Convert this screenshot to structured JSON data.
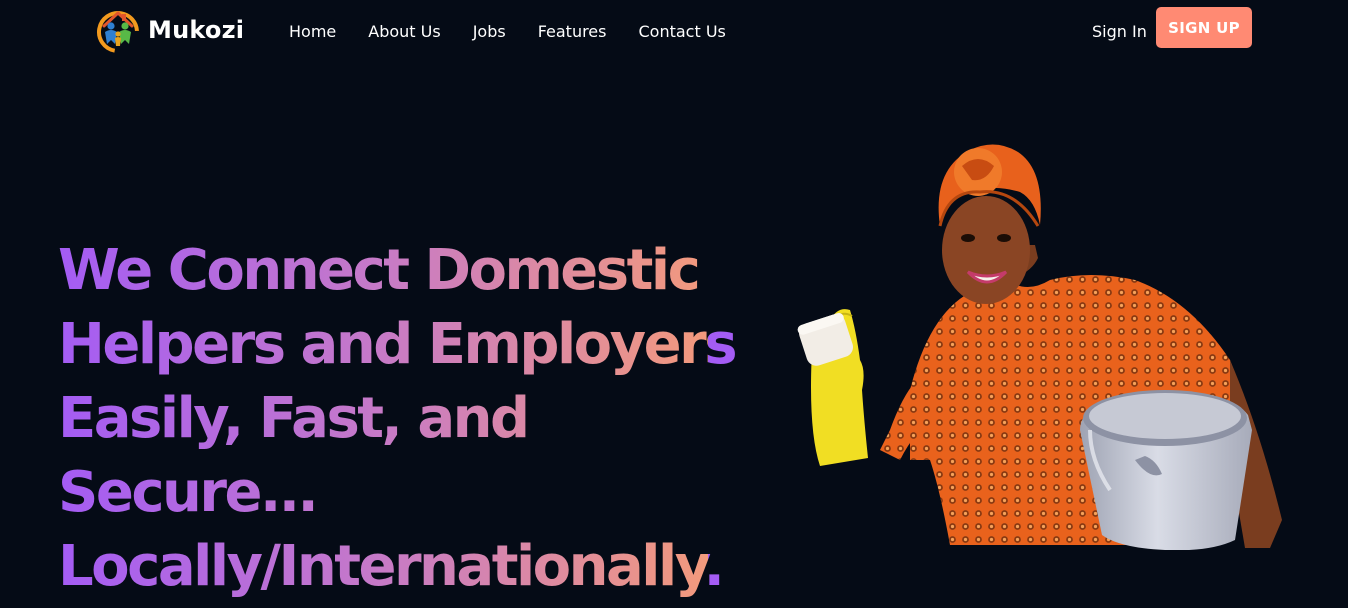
{
  "brand": {
    "name": "Mukozi",
    "logo_icon": "house-family-logo-icon"
  },
  "nav": {
    "items": [
      {
        "label": "Home"
      },
      {
        "label": "About Us"
      },
      {
        "label": "Jobs"
      },
      {
        "label": "Features"
      },
      {
        "label": "Contact Us"
      }
    ],
    "sign_in": "Sign In",
    "sign_up": "SIGN UP"
  },
  "hero": {
    "lines": [
      "We Connect Domestic",
      "Helpers and Employers",
      "Easily, Fast, and",
      "Secure...",
      "Locally/Internationally."
    ],
    "image": "woman-cleaning-with-bucket-illustration"
  },
  "colors": {
    "background": "#050b16",
    "accent": "#ff8a73",
    "gradient_start": "#a45cf4",
    "gradient_end": "#f39a7c"
  }
}
